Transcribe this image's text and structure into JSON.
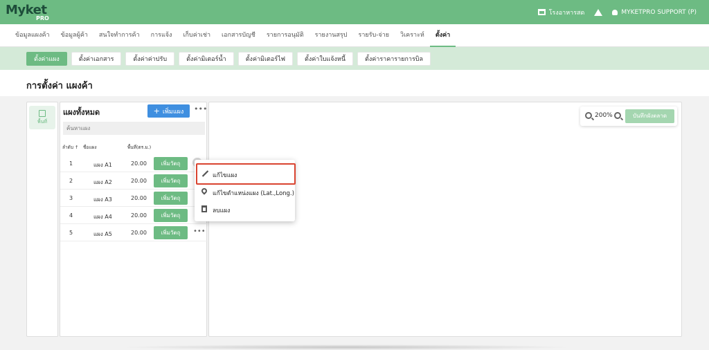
{
  "brand": {
    "logo_text": "Myket",
    "logo_sub": "PRO"
  },
  "topbar": {
    "store_label": "โรงอาหารสด",
    "user_label": "MYKETPRO SUPPORT (P)"
  },
  "main_nav": [
    "ข้อมูลแผงค้า",
    "ข้อมูลผู้ค้า",
    "สนใจทำการค้า",
    "การแจ้ง",
    "เก็บค่าเช่า",
    "เอกสารบัญชี",
    "รายการอนุมัติ",
    "รายงานสรุป",
    "รายรับ-จ่าย",
    "วิเคราะห์",
    "ตั้งค่า"
  ],
  "sub_nav": [
    "ตั้งค่าแผง",
    "ตั้งค่าเอกสาร",
    "ตั้งค่าค่าปรับ",
    "ตั้งค่ามิเตอร์น้ำ",
    "ตั้งค่ามิเตอร์ไฟ",
    "ตั้งค่าใบแจ้งหนี้",
    "ตั้งค่าราคารายการบิล"
  ],
  "page_title": "การตั้งค่า แผงค้า",
  "rail": {
    "label": "พื้นที่"
  },
  "panel": {
    "title": "แผงทั้งหมด",
    "add_button": "เพิ่มแผง",
    "search_placeholder": "ค้นหาแผง",
    "columns": {
      "num": "ลำดับ ↑",
      "name": "ชื่อแผง",
      "area": "พื้นที่(ตร.ม.)"
    },
    "add_object_label": "เพิ่มวัตถุ",
    "rows": [
      {
        "num": "1",
        "name": "แผง A1",
        "area": "20.00"
      },
      {
        "num": "2",
        "name": "แผง A2",
        "area": "20.00"
      },
      {
        "num": "3",
        "name": "แผง A3",
        "area": "20.00"
      },
      {
        "num": "4",
        "name": "แผง A4",
        "area": "20.00"
      },
      {
        "num": "5",
        "name": "แผง A5",
        "area": "20.00"
      }
    ]
  },
  "map": {
    "zoom_level": "200%",
    "save_button": "บันทึกผังตลาด"
  },
  "context_menu": {
    "edit": "แก้ไขแผง",
    "edit_location": "แก้ไขตำแหน่งแผง (Lat.,Long.)",
    "delete": "ลบแผง"
  },
  "colors": {
    "brand_green": "#6dbb83",
    "accent_blue": "#3f8fe0",
    "highlight_red": "#d9432f"
  }
}
